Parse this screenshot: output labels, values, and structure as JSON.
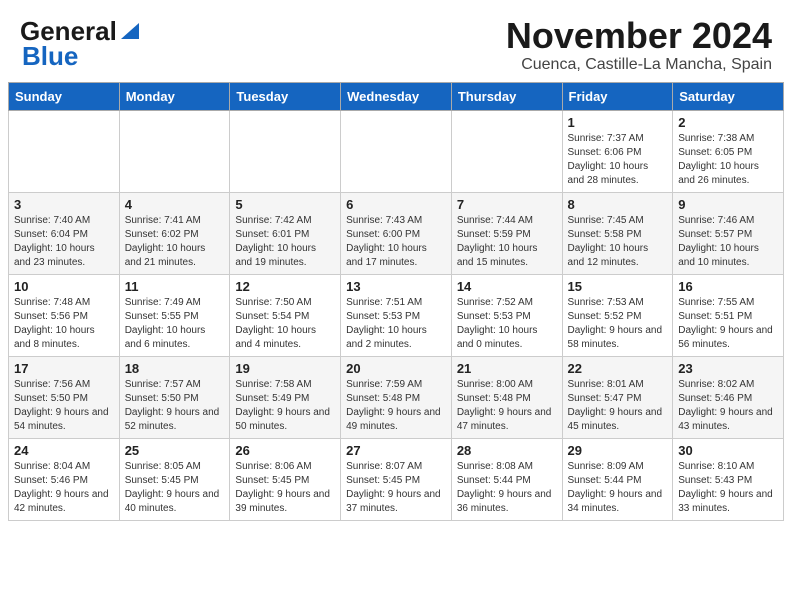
{
  "header": {
    "logo_general": "General",
    "logo_blue": "Blue",
    "month": "November 2024",
    "location": "Cuenca, Castille-La Mancha, Spain"
  },
  "days_of_week": [
    "Sunday",
    "Monday",
    "Tuesday",
    "Wednesday",
    "Thursday",
    "Friday",
    "Saturday"
  ],
  "weeks": [
    [
      {
        "day": "",
        "info": ""
      },
      {
        "day": "",
        "info": ""
      },
      {
        "day": "",
        "info": ""
      },
      {
        "day": "",
        "info": ""
      },
      {
        "day": "",
        "info": ""
      },
      {
        "day": "1",
        "info": "Sunrise: 7:37 AM\nSunset: 6:06 PM\nDaylight: 10 hours and 28 minutes."
      },
      {
        "day": "2",
        "info": "Sunrise: 7:38 AM\nSunset: 6:05 PM\nDaylight: 10 hours and 26 minutes."
      }
    ],
    [
      {
        "day": "3",
        "info": "Sunrise: 7:40 AM\nSunset: 6:04 PM\nDaylight: 10 hours and 23 minutes."
      },
      {
        "day": "4",
        "info": "Sunrise: 7:41 AM\nSunset: 6:02 PM\nDaylight: 10 hours and 21 minutes."
      },
      {
        "day": "5",
        "info": "Sunrise: 7:42 AM\nSunset: 6:01 PM\nDaylight: 10 hours and 19 minutes."
      },
      {
        "day": "6",
        "info": "Sunrise: 7:43 AM\nSunset: 6:00 PM\nDaylight: 10 hours and 17 minutes."
      },
      {
        "day": "7",
        "info": "Sunrise: 7:44 AM\nSunset: 5:59 PM\nDaylight: 10 hours and 15 minutes."
      },
      {
        "day": "8",
        "info": "Sunrise: 7:45 AM\nSunset: 5:58 PM\nDaylight: 10 hours and 12 minutes."
      },
      {
        "day": "9",
        "info": "Sunrise: 7:46 AM\nSunset: 5:57 PM\nDaylight: 10 hours and 10 minutes."
      }
    ],
    [
      {
        "day": "10",
        "info": "Sunrise: 7:48 AM\nSunset: 5:56 PM\nDaylight: 10 hours and 8 minutes."
      },
      {
        "day": "11",
        "info": "Sunrise: 7:49 AM\nSunset: 5:55 PM\nDaylight: 10 hours and 6 minutes."
      },
      {
        "day": "12",
        "info": "Sunrise: 7:50 AM\nSunset: 5:54 PM\nDaylight: 10 hours and 4 minutes."
      },
      {
        "day": "13",
        "info": "Sunrise: 7:51 AM\nSunset: 5:53 PM\nDaylight: 10 hours and 2 minutes."
      },
      {
        "day": "14",
        "info": "Sunrise: 7:52 AM\nSunset: 5:53 PM\nDaylight: 10 hours and 0 minutes."
      },
      {
        "day": "15",
        "info": "Sunrise: 7:53 AM\nSunset: 5:52 PM\nDaylight: 9 hours and 58 minutes."
      },
      {
        "day": "16",
        "info": "Sunrise: 7:55 AM\nSunset: 5:51 PM\nDaylight: 9 hours and 56 minutes."
      }
    ],
    [
      {
        "day": "17",
        "info": "Sunrise: 7:56 AM\nSunset: 5:50 PM\nDaylight: 9 hours and 54 minutes."
      },
      {
        "day": "18",
        "info": "Sunrise: 7:57 AM\nSunset: 5:50 PM\nDaylight: 9 hours and 52 minutes."
      },
      {
        "day": "19",
        "info": "Sunrise: 7:58 AM\nSunset: 5:49 PM\nDaylight: 9 hours and 50 minutes."
      },
      {
        "day": "20",
        "info": "Sunrise: 7:59 AM\nSunset: 5:48 PM\nDaylight: 9 hours and 49 minutes."
      },
      {
        "day": "21",
        "info": "Sunrise: 8:00 AM\nSunset: 5:48 PM\nDaylight: 9 hours and 47 minutes."
      },
      {
        "day": "22",
        "info": "Sunrise: 8:01 AM\nSunset: 5:47 PM\nDaylight: 9 hours and 45 minutes."
      },
      {
        "day": "23",
        "info": "Sunrise: 8:02 AM\nSunset: 5:46 PM\nDaylight: 9 hours and 43 minutes."
      }
    ],
    [
      {
        "day": "24",
        "info": "Sunrise: 8:04 AM\nSunset: 5:46 PM\nDaylight: 9 hours and 42 minutes."
      },
      {
        "day": "25",
        "info": "Sunrise: 8:05 AM\nSunset: 5:45 PM\nDaylight: 9 hours and 40 minutes."
      },
      {
        "day": "26",
        "info": "Sunrise: 8:06 AM\nSunset: 5:45 PM\nDaylight: 9 hours and 39 minutes."
      },
      {
        "day": "27",
        "info": "Sunrise: 8:07 AM\nSunset: 5:45 PM\nDaylight: 9 hours and 37 minutes."
      },
      {
        "day": "28",
        "info": "Sunrise: 8:08 AM\nSunset: 5:44 PM\nDaylight: 9 hours and 36 minutes."
      },
      {
        "day": "29",
        "info": "Sunrise: 8:09 AM\nSunset: 5:44 PM\nDaylight: 9 hours and 34 minutes."
      },
      {
        "day": "30",
        "info": "Sunrise: 8:10 AM\nSunset: 5:43 PM\nDaylight: 9 hours and 33 minutes."
      }
    ]
  ]
}
